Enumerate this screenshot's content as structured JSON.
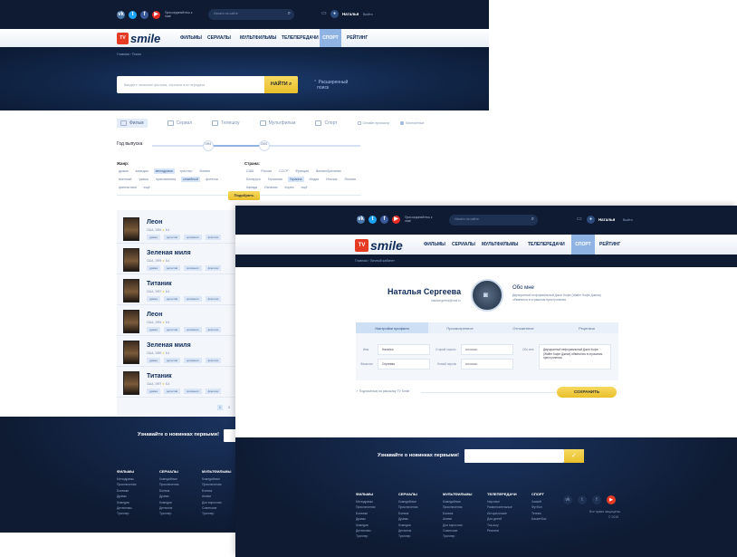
{
  "social": {
    "vk": "vk",
    "tw": "t",
    "fb": "f",
    "yt": "▶"
  },
  "header": {
    "tagline": "Присоединяйтесь к нам!",
    "search_placeholder": "Искать на сайте",
    "user_name": "Наталья",
    "exit": "Выйти"
  },
  "logo": {
    "box": "TV",
    "word": "smile"
  },
  "nav": [
    "ФИЛЬМЫ",
    "СЕРИАЛЫ",
    "МУЛЬТФИЛЬМЫ",
    "ТЕЛЕПЕРЕДАЧИ",
    "СПОРТ",
    "РЕЙТИНГ"
  ],
  "search_page": {
    "breadcrumb": "Главная › Поиск",
    "search_placeholder": "Введите название фильма, сериала или передачи",
    "find_button": "НАЙТИ",
    "advanced_line1": "Расширенный",
    "advanced_line2": "поиск",
    "tabs": [
      "Фильм",
      "Сериал",
      "Телешоу",
      "Мультфильм",
      "Спорт"
    ],
    "checks": [
      "Онлайн просмотр",
      "Бесплатные"
    ],
    "year_label": "Год выпуска",
    "year_from": "1994",
    "year_to": "2005",
    "genre_label": "Жанр:",
    "genres": [
      "драма",
      "комедия",
      "мелодрама",
      "триллер",
      "боевик",
      "военный",
      "ужасы",
      "приключения",
      "семейный",
      "фэнтези",
      "фантастика",
      "ещё"
    ],
    "genre_selected": [
      "мелодрама",
      "семейный"
    ],
    "country_label": "Страна:",
    "countries": [
      "США",
      "Россия",
      "СССР",
      "Франция",
      "Великобритания",
      "Беларусь",
      "Германия",
      "Украина",
      "Индия",
      "Италия",
      "Япония",
      "Канада",
      "Испания",
      "Корея",
      "ещё"
    ],
    "country_selected": [
      "Украина"
    ],
    "pick_button": "Подобрать",
    "results": [
      {
        "title": "Леон",
        "meta": "США, 1994",
        "rating": "8.4",
        "tags": [
          "драма",
          "детектив",
          "криминал",
          "фэнтези"
        ]
      },
      {
        "title": "Зеленая миля",
        "meta": "США, 1999",
        "rating": "8.4",
        "tags": [
          "драма",
          "детектив",
          "криминал",
          "фэнтези"
        ]
      },
      {
        "title": "Титаник",
        "meta": "США, 1997",
        "rating": "8.4",
        "tags": [
          "драма",
          "детектив",
          "криминал",
          "фэнтези"
        ]
      },
      {
        "title": "Леон",
        "meta": "США, 1994",
        "rating": "8.4",
        "tags": [
          "драма",
          "детектив",
          "криминал",
          "фэнтези"
        ]
      },
      {
        "title": "Зеленая миля",
        "meta": "США, 1999",
        "rating": "8.4",
        "tags": [
          "драма",
          "детектив",
          "криминал",
          "фэнтези"
        ]
      },
      {
        "title": "Титаник",
        "meta": "США, 1997",
        "rating": "8.4",
        "tags": [
          "драма",
          "детектив",
          "криминал",
          "фэнтези"
        ]
      }
    ],
    "pages": [
      "1",
      "2"
    ]
  },
  "footer": {
    "subscribe": "Узнавайте о новинках первыми!",
    "mail_button": "✓",
    "cols": [
      {
        "head": "ФИЛЬМЫ",
        "links": [
          "Мелодрамы",
          "Приключения",
          "Боевики",
          "Драмы",
          "Комедии",
          "Детективы",
          "Триллер"
        ]
      },
      {
        "head": "СЕРИАЛЫ",
        "links": [
          "Комедийные",
          "Приключения",
          "Боевик",
          "Драмы",
          "Комедии",
          "Детектив",
          "Триллер"
        ]
      },
      {
        "head": "МУЛЬТФИЛЬМЫ",
        "links": [
          "Комедийные",
          "Приключения",
          "Боевик",
          "Аниме",
          "Для взрослых",
          "Советские",
          "Триллер"
        ]
      },
      {
        "head": "ТЕЛЕПЕРЕДАЧИ",
        "links": [
          "Научные",
          "Развлекательные",
          "Исторические",
          "Для детей",
          "Ток-шоу",
          "Реалити"
        ]
      },
      {
        "head": "СПОРТ",
        "links": [
          "Хоккей",
          "Футбол",
          "Теннис",
          "Баскетбол"
        ]
      }
    ],
    "copyright1": "Все права защищены",
    "copyright2": "© 2015"
  },
  "profile_page": {
    "breadcrumb": "Главная › Личный кабинет",
    "name": "Наталья Сергеева",
    "email": "natalsergeeva@mail.ru",
    "about_head": "Обо мне",
    "about_text": "Двухкратный неформальный Джон Кофе (Walter Кофе Джека) обвинился в страшном преступлении",
    "tabs": [
      "Настройки профиля",
      "Просмотренное",
      "Отложенное",
      "Рецензии"
    ],
    "labels": {
      "name": "Имя",
      "last": "Фамилия",
      "oldpass": "Старый пароль",
      "newpass": "Новый пароль",
      "about": "Обо мне"
    },
    "values": {
      "name": "Наталья",
      "last": "Сергеева",
      "oldpass": "••••••••••••",
      "newpass": "••••••••••••"
    },
    "about_field": "Двухкратный неформальный Джон Кофе (Walter Кофе Джека) обвинился в страшном преступлении",
    "subscribe_check": "Подписаться на рассылку TV Smile",
    "save_button": "СОХРАНИТЬ"
  }
}
